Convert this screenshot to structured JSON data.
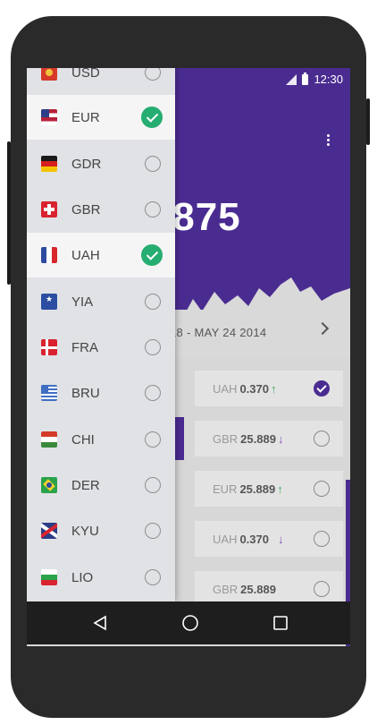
{
  "status_bar": {
    "time": "12:30"
  },
  "rate": {
    "value": ".875"
  },
  "date_range": {
    "text": "18 - MAY 24 2014"
  },
  "drawer": {
    "items": [
      {
        "code": "USD",
        "flag": "usd-flag-icon",
        "checked": false
      },
      {
        "code": "EUR",
        "flag": "us-flag-icon",
        "checked": true
      },
      {
        "code": "GDR",
        "flag": "germany-flag-icon",
        "checked": false
      },
      {
        "code": "GBR",
        "flag": "swiss-flag-icon",
        "checked": false
      },
      {
        "code": "UAH",
        "flag": "france-flag-icon",
        "checked": true
      },
      {
        "code": "YIA",
        "flag": "star-flag-icon",
        "checked": false
      },
      {
        "code": "FRA",
        "flag": "denmark-flag-icon",
        "checked": false
      },
      {
        "code": "BRU",
        "flag": "greece-flag-icon",
        "checked": false
      },
      {
        "code": "CHI",
        "flag": "hungary-flag-icon",
        "checked": false
      },
      {
        "code": "DER",
        "flag": "brazil-flag-icon",
        "checked": false
      },
      {
        "code": "KYU",
        "flag": "uk-flag-icon",
        "checked": false
      },
      {
        "code": "LIO",
        "flag": "bulgaria-flag-icon",
        "checked": false
      }
    ]
  },
  "cards": [
    {
      "cur": "UAH",
      "val": "0.370",
      "trend": "up",
      "checked": true
    },
    {
      "cur": "GBR",
      "val": "25.889",
      "trend": "down",
      "checked": false
    },
    {
      "cur": "EUR",
      "val": "25.889",
      "trend": "up",
      "checked": false
    },
    {
      "cur": "UAH",
      "val": "0.370",
      "trend": "down",
      "checked": false
    },
    {
      "cur": "GBR",
      "val": "25.889",
      "trend": "",
      "checked": false
    }
  ],
  "colors": {
    "primary": "#4a2c91",
    "accent": "#26ad72",
    "up": "#3fa85a",
    "down": "#7a4fb5"
  }
}
